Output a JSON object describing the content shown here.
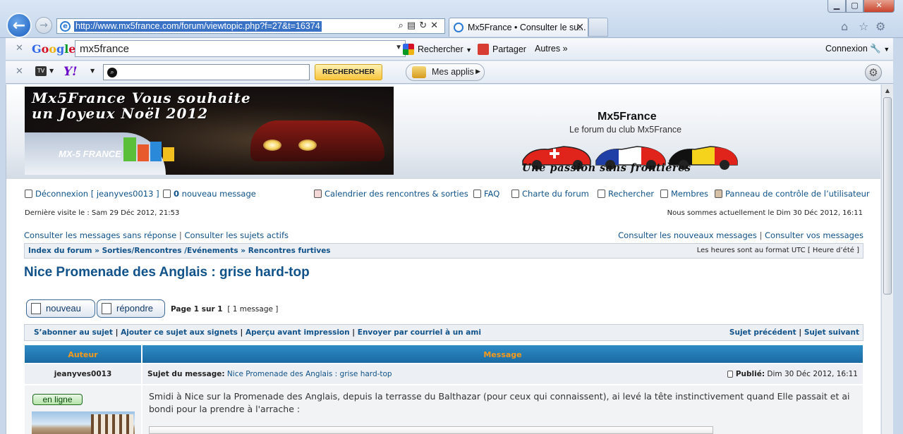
{
  "browser": {
    "url": "http://www.mx5france.com/forum/viewtopic.php?f=27&t=16374",
    "tab_title": "Mx5France • Consulter le su...",
    "window_controls": [
      "min",
      "max",
      "close"
    ]
  },
  "google_toolbar": {
    "logo": "Google",
    "search_value": "mx5france",
    "rechercher": "Rechercher",
    "partager": "Partager",
    "autres": "Autres »",
    "connexion": "Connexion"
  },
  "yahoo_toolbar": {
    "logo": "Y!",
    "search_button": "RECHERCHER",
    "mes_applis": "Mes applis"
  },
  "banner": {
    "line1": "Mx5France Vous souhaite",
    "line2": "un Joyeux Noël 2012",
    "logo_text": "MX-5 FRANCE"
  },
  "site": {
    "title": "Mx5France",
    "subtitle": "Le forum du club Mx5France",
    "slogan": "Une passion sans frontières"
  },
  "userbar": {
    "logout": "Déconnexion [ jeanyves0013 ]",
    "messages_count": "0",
    "messages_label": "nouveau message",
    "calendar": "Calendrier des rencontres & sorties",
    "faq": "FAQ",
    "charte": "Charte du forum",
    "search": "Rechercher",
    "members": "Membres",
    "control_panel": "Panneau de contrôle de l’utilisateur"
  },
  "visit": {
    "last": "Dernière visite le : Sam 29 Déc 2012, 21:53",
    "now": "Nous sommes actuellement le Dim 30 Déc 2012, 16:11"
  },
  "quicklinks": {
    "unanswered": "Consulter les messages sans réponse",
    "active": "Consulter les sujets actifs",
    "new_posts": "Consulter les nouveaux messages",
    "your_posts": "Consulter vos messages"
  },
  "breadcrumb": {
    "index": "Index du forum",
    "sorties": "Sorties/Rencontres /Evénements",
    "furtives": "Rencontres furtives",
    "sep": "»",
    "timezone": "Les heures sont au format UTC [ Heure d’été ]"
  },
  "topic": {
    "title": "Nice Promenade des Anglais : grise hard-top"
  },
  "pagination": {
    "new_button": "nouveau",
    "reply_button": "répondre",
    "page": "Page 1 sur 1",
    "count": "[ 1 message ]"
  },
  "actions": {
    "subscribe": "S’abonner au sujet",
    "bookmark": "Ajouter ce sujet aux signets",
    "print": "Aperçu avant impression",
    "email": "Envoyer par courriel à un ami",
    "sep": "|",
    "prev": "Sujet précédent",
    "next": "Sujet suivant"
  },
  "table": {
    "author_header": "Auteur",
    "message_header": "Message"
  },
  "post": {
    "author": "jeanyves0013",
    "subject_label": "Sujet du message:",
    "subject": "Nice Promenade des Anglais : grise hard-top",
    "published_label": "Publié:",
    "published_date": "Dim 30 Déc 2012, 16:11",
    "status": "en ligne",
    "body": "Smidi à Nice sur la Promenade des Anglais, depuis la terrasse du Balthazar (pour ceux qui connaissent), ai levé la tête instinctivement quand Elle passait et ai bondi pour la prendre à l'arrache :"
  }
}
